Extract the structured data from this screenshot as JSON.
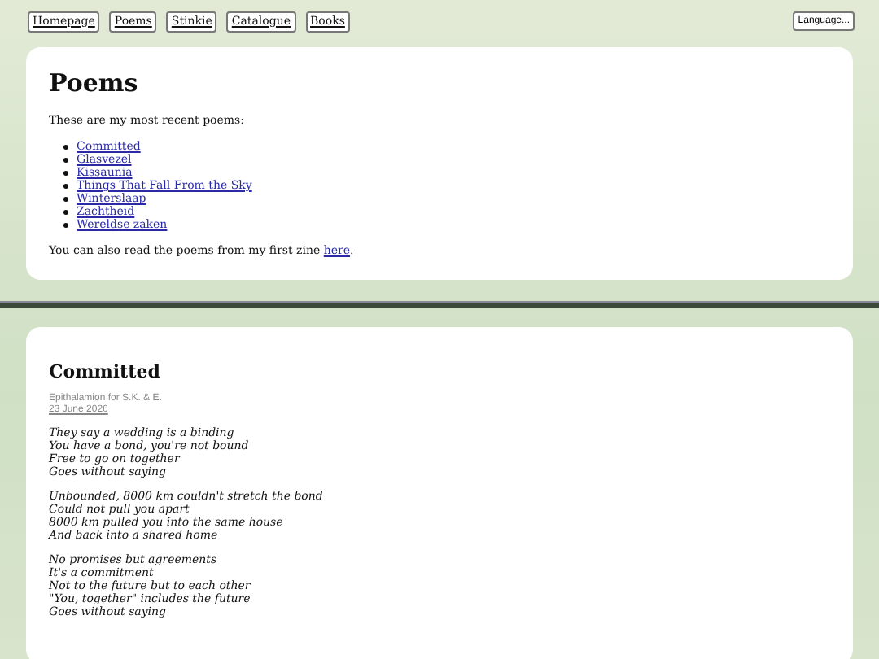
{
  "nav": {
    "links": [
      "Homepage",
      "Poems",
      "Stinkie",
      "Catalogue",
      "Books"
    ],
    "language_button": "Language..."
  },
  "intro": {
    "title": "Poems",
    "lead": "These are my most recent poems:",
    "poems": [
      "Committed",
      "Glasvezel",
      "Kissaunia",
      "Things That Fall From the Sky",
      "Winterslaap",
      "Zachtheid",
      "Wereldse zaken"
    ],
    "zine_text": "You can also read the poems from my first zine",
    "zine_link": "here",
    "zine_end": "."
  },
  "poem": {
    "title": "Committed",
    "subtitle": "Epithalamion for S.K. & E.",
    "date": "23 June 2026",
    "stanzas": [
      [
        "They say a wedding is a binding",
        "You have a bond, you're not bound",
        "Free to go on together",
        "Goes without saying"
      ],
      [
        "Unbounded, 8000 km couldn't stretch the bond",
        "Could not pull you apart",
        "8000 km pulled you into the same house",
        "And back into a shared home"
      ],
      [
        "No promises but agreements",
        "It's a commitment",
        "Not to the future but to each other",
        "\"You, together\" includes the future",
        "Goes without saying"
      ]
    ]
  }
}
